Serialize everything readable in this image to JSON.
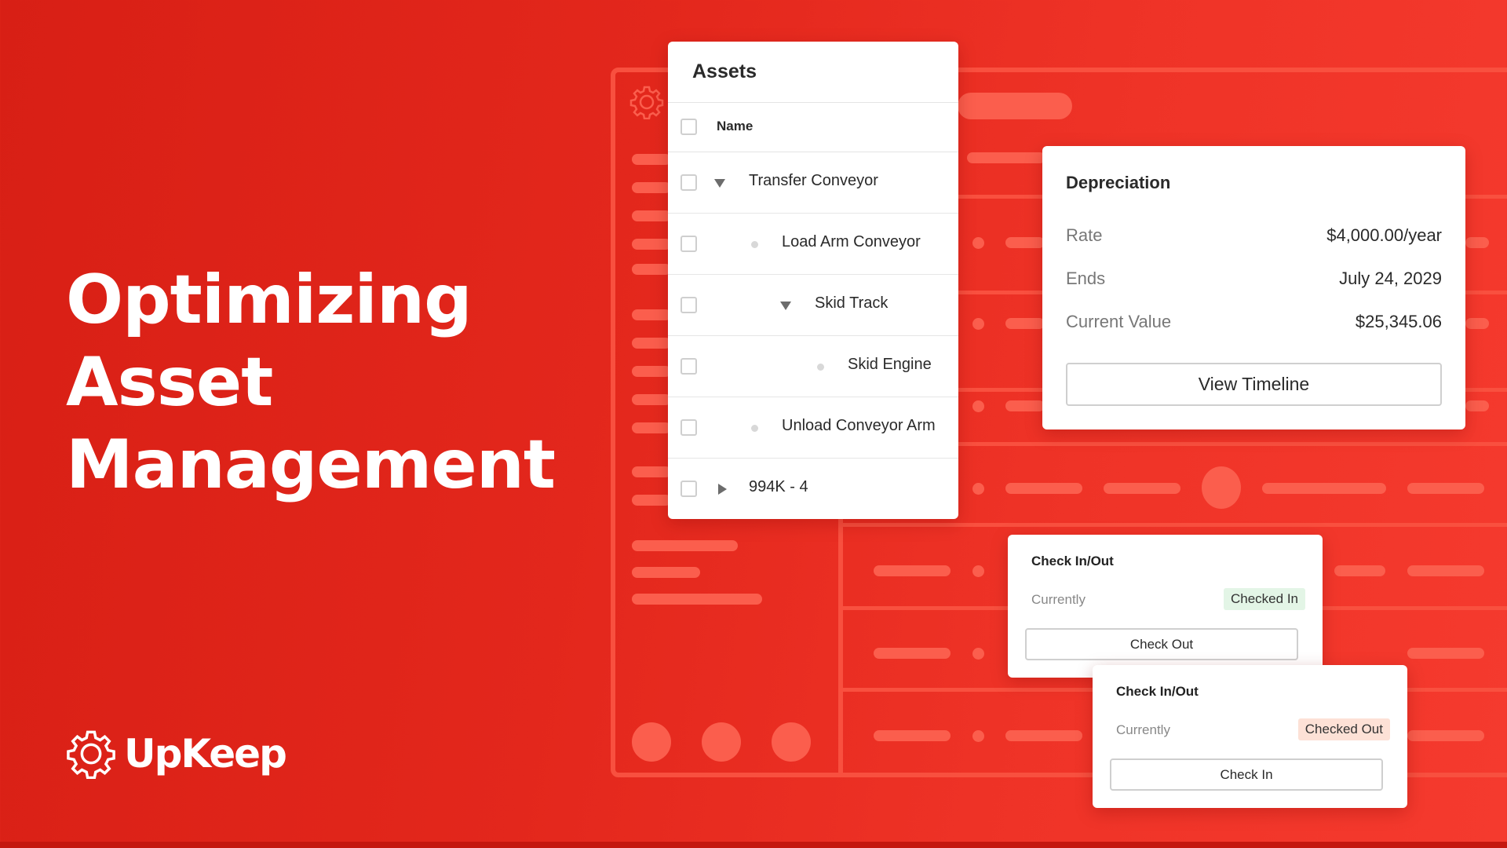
{
  "headline": {
    "lines": [
      "Optimizing",
      "Asset",
      "Management"
    ]
  },
  "brand": {
    "name": "UpKeep",
    "icon": "gear-icon",
    "colors": {
      "primary_red": "#e3271c",
      "white": "#ffffff"
    }
  },
  "assets_panel": {
    "title": "Assets",
    "column_header": "Name",
    "rows": [
      {
        "label": "Transfer Conveyor",
        "level": 0,
        "toggle": "expanded"
      },
      {
        "label": "Load Arm Conveyor",
        "level": 1,
        "toggle": "leaf"
      },
      {
        "label": "Skid Track",
        "level": 1,
        "toggle": "expanded"
      },
      {
        "label": "Skid Engine",
        "level": 2,
        "toggle": "leaf"
      },
      {
        "label": "Unload Conveyor Arm",
        "level": 1,
        "toggle": "leaf"
      },
      {
        "label": "994K - 4",
        "level": 0,
        "toggle": "collapsed"
      }
    ]
  },
  "depreciation": {
    "title": "Depreciation",
    "fields": [
      {
        "label": "Rate",
        "value": "$4,000.00/year"
      },
      {
        "label": "Ends",
        "value": "July 24, 2029"
      },
      {
        "label": "Current Value",
        "value": "$25,345.06"
      }
    ],
    "button_label": "View Timeline"
  },
  "check_cards": [
    {
      "title": "Check In/Out",
      "label": "Currently",
      "status": "Checked In",
      "status_color": "#e3f5e6",
      "button_label": "Check Out"
    },
    {
      "title": "Check In/Out",
      "label": "Currently",
      "status": "Checked Out",
      "status_color": "#fde1d6",
      "button_label": "Check In"
    }
  ]
}
